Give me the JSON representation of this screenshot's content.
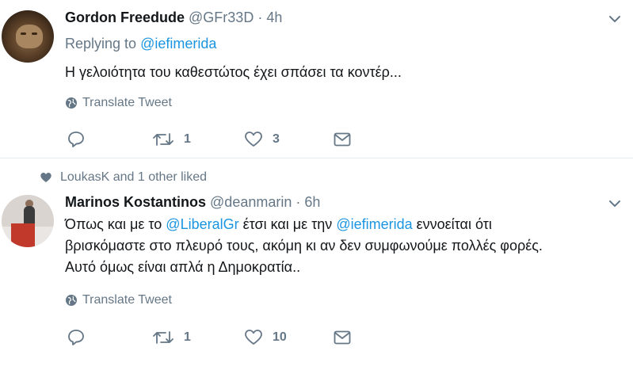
{
  "tweets": [
    {
      "author_name": "Gordon Freedude",
      "author_handle": "@GFr33D",
      "separator": "·",
      "time": "4h",
      "replying_label": "Replying to",
      "replying_to": "@iefimerida",
      "text": "Η γελοιότητα του καθεστώτος έχει σπάσει τα κοντέρ...",
      "translate_label": "Translate Tweet",
      "retweet_count": "1",
      "like_count": "3"
    },
    {
      "liked_by": "LoukasK and 1 other liked",
      "author_name": "Marinos Kostantinos",
      "author_handle": "@deanmarin",
      "separator": "·",
      "time": "6h",
      "text_line1_a": "Όπως και με το ",
      "mention1": "@LiberalGr",
      "text_line1_b": " έτσι και με την ",
      "mention2": "@iefimerida",
      "text_line1_c": " εννοείται ότι",
      "text_line2": "βρισκόμαστε στο πλευρό τους, ακόμη κι αν δεν συμφωνούμε πολλές φορές.",
      "text_line3": "Αυτό όμως είναι απλά η Δημοκρατία..",
      "translate_label": "Translate Tweet",
      "retweet_count": "1",
      "like_count": "10"
    }
  ],
  "colors": {
    "link": "#1b95e0",
    "muted": "#657786",
    "text": "#14171a",
    "divider": "#e6ecf0"
  },
  "icons": [
    "reply-icon",
    "retweet-icon",
    "heart-icon",
    "message-icon",
    "globe-icon",
    "chevron-down-icon"
  ]
}
